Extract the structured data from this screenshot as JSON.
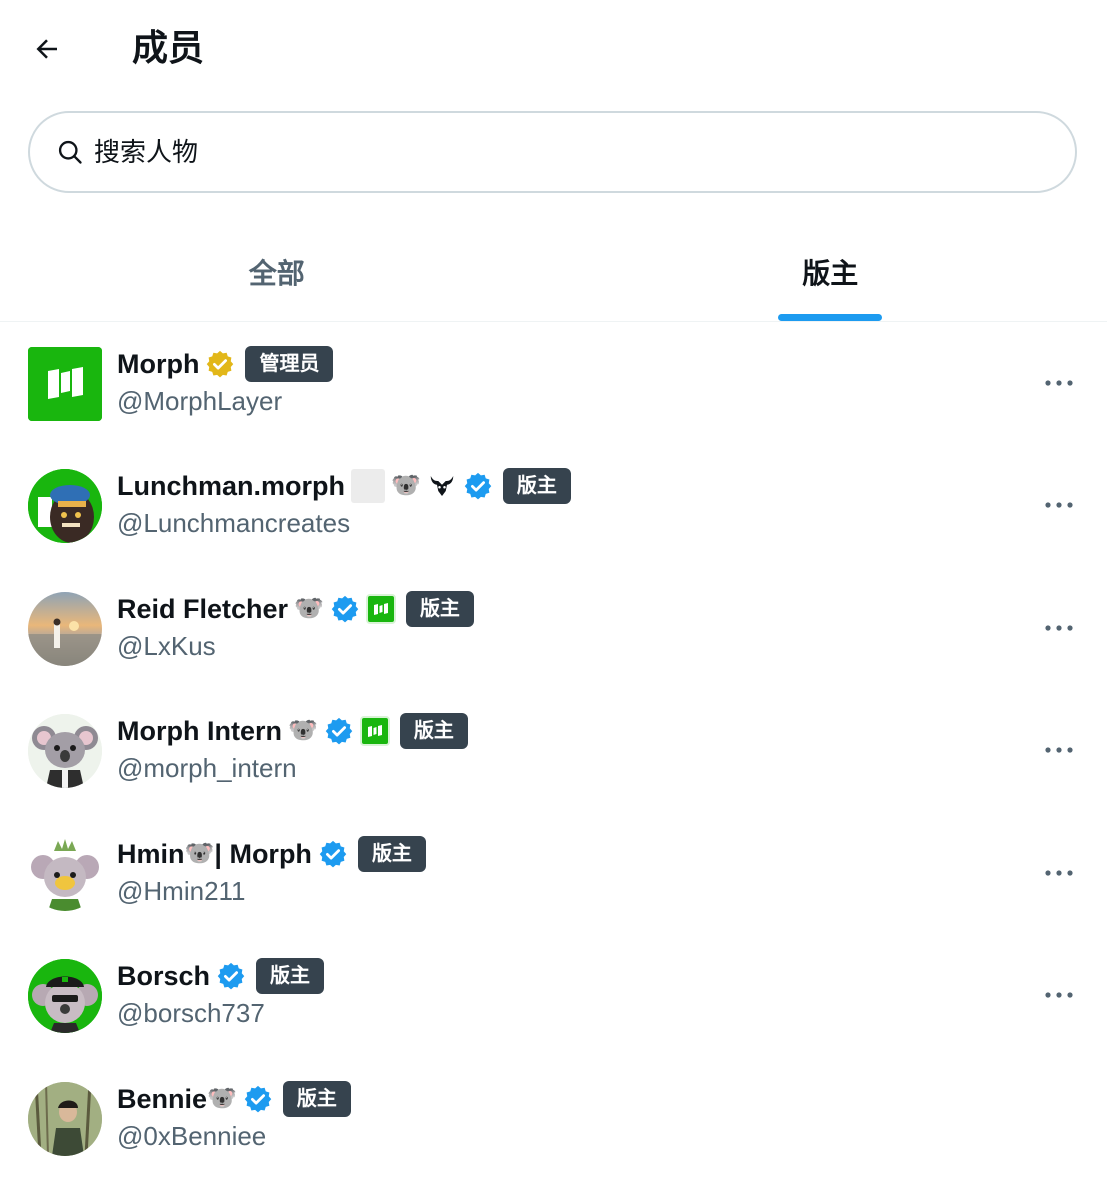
{
  "header": {
    "title": "成员",
    "back_icon": "arrow-left-icon"
  },
  "search": {
    "placeholder": "搜索人物",
    "value": "",
    "icon": "search-icon"
  },
  "tabs": [
    {
      "label": "全部",
      "active": false
    },
    {
      "label": "版主",
      "active": true
    }
  ],
  "colors": {
    "accent": "#1d9bf0",
    "badge_bg": "#36434e",
    "verified_blue": "#1d9bf0",
    "verified_gold": "#e2b719",
    "brand_green": "#19b60e",
    "secondary_text": "#536471"
  },
  "members": [
    {
      "name": "Morph",
      "handle": "@MorphLayer",
      "badge": "管理员",
      "verified": "gold",
      "emoji": [],
      "avatar": "morph-logo"
    },
    {
      "name": "Lunchman.morph",
      "handle": "@Lunchmancreates",
      "badge": "版主",
      "verified": "blue",
      "emoji": [
        "🐨"
      ],
      "avatar": "lunchman"
    },
    {
      "name": "Reid Fletcher",
      "handle": "@LxKus",
      "badge": "版主",
      "verified": "blue",
      "emoji": [
        "🐨"
      ],
      "avatar": "sunset-photo"
    },
    {
      "name": "Morph Intern",
      "handle": "@morph_intern",
      "badge": "版主",
      "verified": "blue",
      "emoji": [
        "🐨"
      ],
      "avatar": "koala"
    },
    {
      "name_prefix": "Hmin",
      "name_suffix": " | Morph",
      "handle": "@Hmin211",
      "badge": "版主",
      "verified": "blue",
      "emoji": [
        "🐨"
      ],
      "avatar": "koala-crown"
    },
    {
      "name": "Borsch",
      "handle": "@borsch737",
      "badge": "版主",
      "verified": "blue",
      "emoji": [],
      "avatar": "koala-cap"
    },
    {
      "name": "Bennie",
      "handle": "@0xBenniee",
      "badge": "版主",
      "verified": "blue",
      "emoji": [
        "🐨"
      ],
      "avatar": "forest-photo"
    }
  ]
}
